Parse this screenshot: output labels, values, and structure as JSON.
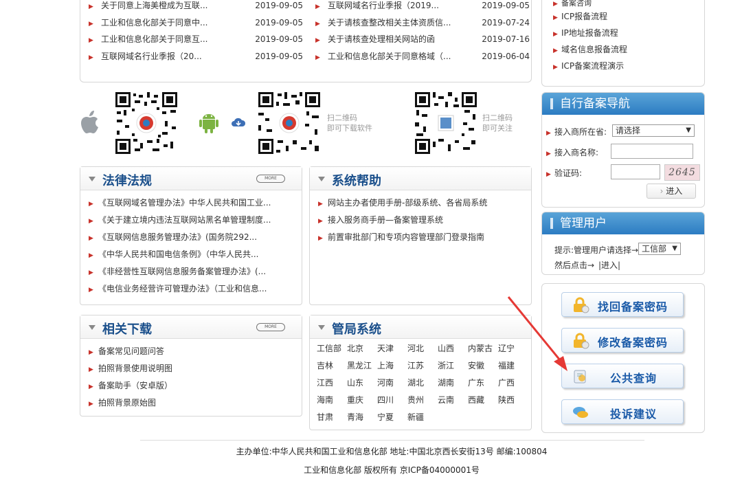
{
  "news": {
    "left": [
      {
        "title": "关于同意上海美橙成为互联...",
        "date": "2019-09-05"
      },
      {
        "title": "工业和信息化部关于同意中...",
        "date": "2019-09-05"
      },
      {
        "title": "工业和信息化部关于同意互...",
        "date": "2019-09-05"
      },
      {
        "title": "互联网域名行业季报（20...",
        "date": "2019-09-05"
      }
    ],
    "right": [
      {
        "title": "互联网域名行业季报（2019...",
        "date": "2019-09-05"
      },
      {
        "title": "关于请核查整改相关主体资质信...",
        "date": "2019-07-24"
      },
      {
        "title": "关于请核查处理相关网站的函",
        "date": "2019-07-16"
      },
      {
        "title": "工业和信息化部关于同意格域（...",
        "date": "2019-06-04"
      }
    ]
  },
  "qr": {
    "caption1_line1": "扫二维码",
    "caption1_line2": "即可下载软件",
    "caption2_line1": "扫二维码",
    "caption2_line2": "即可关注"
  },
  "law": {
    "title": "法律法规",
    "more": "MORE",
    "items": [
      "《互联网域名管理办法》中华人民共和国工业...",
      "《关于建立境内违法互联网站黑名单管理制度...",
      "《互联网信息服务管理办法》(国务院292...",
      "《中华人民共和国电信条例》（中华人民共...",
      "《非经营性互联网信息服务备案管理办法》(...",
      "《电信业务经营许可管理办法》（工业和信息..."
    ]
  },
  "help": {
    "title": "系统帮助",
    "items": [
      "网站主办者使用手册-部级系统、各省局系统",
      "接入服务商手册—备案管理系统",
      "前置审批部门和专项内容管理部门登录指南"
    ]
  },
  "download": {
    "title": "相关下载",
    "more": "MORE",
    "items": [
      "备案常见问题问答",
      "拍照背景使用说明图",
      "备案助手（安卓版）",
      "拍照背景原始图"
    ]
  },
  "bureau": {
    "title": "管局系统",
    "cities": [
      "工信部",
      "北京",
      "天津",
      "河北",
      "山西",
      "内蒙古",
      "辽宁",
      "吉林",
      "黑龙江",
      "上海",
      "江苏",
      "浙江",
      "安徽",
      "福建",
      "江西",
      "山东",
      "河南",
      "湖北",
      "湖南",
      "广东",
      "广西",
      "海南",
      "重庆",
      "四川",
      "贵州",
      "云南",
      "西藏",
      "陕西",
      "甘肃",
      "青海",
      "宁夏",
      "新疆"
    ]
  },
  "side_links": [
    "备案咨询",
    "ICP报备流程",
    "IP地址报备流程",
    "域名信息报备流程",
    "ICP备案流程演示"
  ],
  "self_filing": {
    "title": "自行备案导航",
    "isp_label": "接入商所在省:",
    "isp_select": "请选择",
    "name_label": "接入商名称:",
    "captcha_label": "验证码:",
    "captcha_text": "2645",
    "submit": "进入"
  },
  "admin": {
    "title": "管理用户",
    "prompt": "提示:管理用户请选择→",
    "select": "工信部",
    "then": "然后点击→",
    "enter": "|进入|"
  },
  "actions": [
    "找回备案密码",
    "修改备案密码",
    "公共查询",
    "投诉建议"
  ],
  "footer": {
    "line1": "主办单位:中华人民共和国工业和信息化部 地址:中国北京西长安街13号 邮编:100804",
    "line2": "工业和信息化部 版权所有 京ICP备04000001号"
  },
  "colors": {
    "accent": "#2c7cc2",
    "bullet": "#c8322b",
    "heading": "#1a4f8b",
    "arrow": "#e53935"
  }
}
